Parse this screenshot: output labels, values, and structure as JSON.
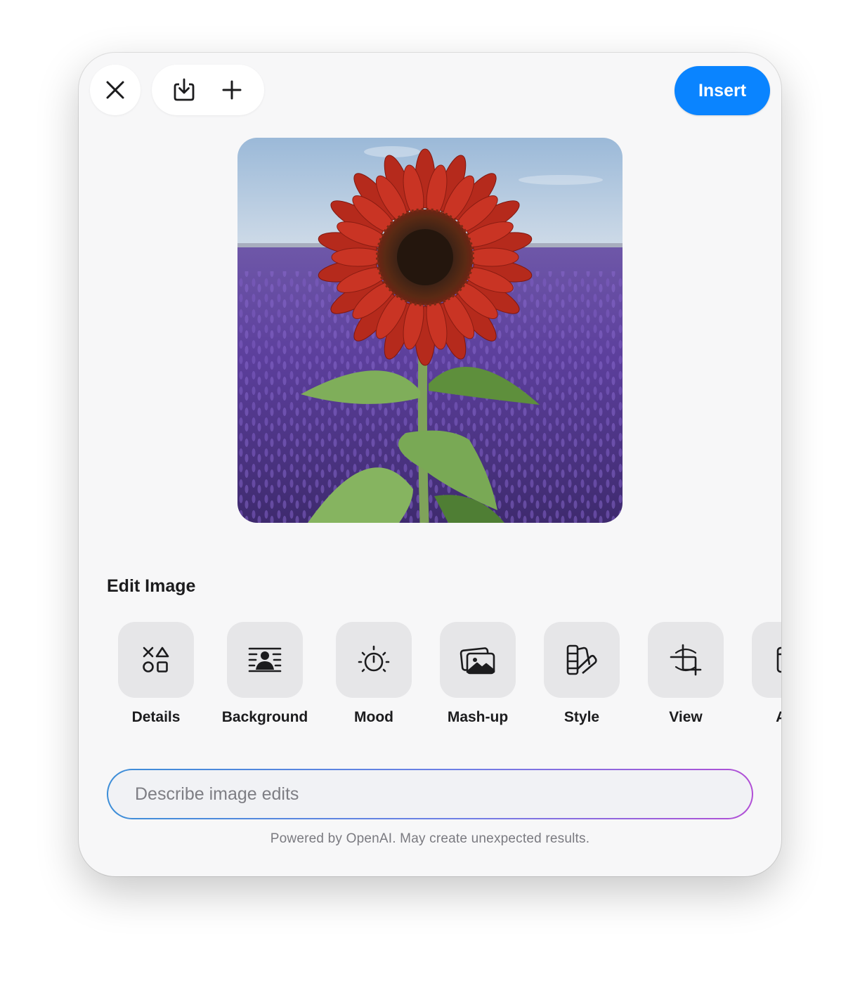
{
  "toolbar": {
    "close_icon": "close-icon",
    "download_icon": "download-icon",
    "add_icon": "plus-icon",
    "insert_label": "Insert",
    "accent_color": "#0a84ff"
  },
  "preview": {
    "subject": "red-sunflower-in-lavender-field"
  },
  "edit_section": {
    "title": "Edit Image",
    "tools": [
      {
        "label": "Details",
        "icon": "shapes-icon"
      },
      {
        "label": "Background",
        "icon": "background-icon"
      },
      {
        "label": "Mood",
        "icon": "mood-icon"
      },
      {
        "label": "Mash-up",
        "icon": "photos-icon"
      },
      {
        "label": "Style",
        "icon": "swatches-icon"
      },
      {
        "label": "View",
        "icon": "crop-icon"
      },
      {
        "label": "Asp",
        "icon": "layout-icon"
      }
    ]
  },
  "prompt": {
    "placeholder": "Describe image edits",
    "value": ""
  },
  "footer": {
    "note": "Powered by OpenAI. May create unexpected results."
  }
}
